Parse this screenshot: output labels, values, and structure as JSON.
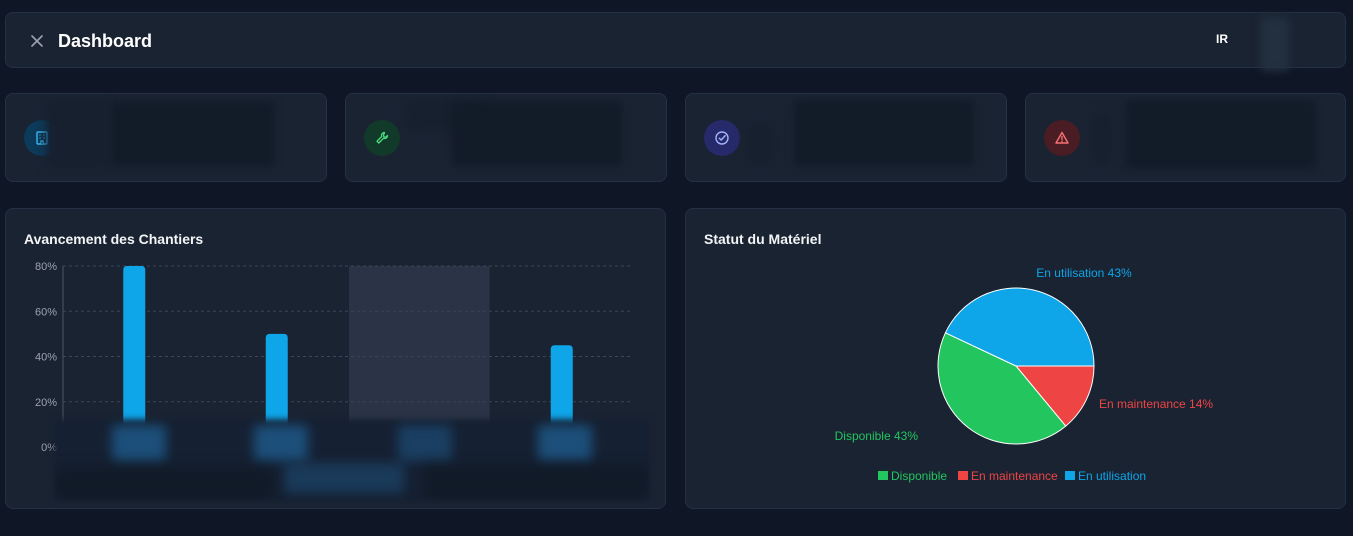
{
  "header": {
    "title": "Dashboard",
    "avatar_initials": "IR",
    "close_icon": "close-icon"
  },
  "stat_cards": [
    {
      "icon": "building-icon",
      "color": "#0ea5e9"
    },
    {
      "icon": "wrench-icon",
      "color": "#22c55e"
    },
    {
      "icon": "check-circle-icon",
      "color": "#6366f1"
    },
    {
      "icon": "alert-triangle-icon",
      "color": "#ef4444"
    }
  ],
  "projects_panel": {
    "title": "Avancement des Chantiers"
  },
  "equipment_panel": {
    "title": "Statut du Matériel"
  },
  "chart_data": [
    {
      "type": "bar",
      "title": "Avancement des Chantiers",
      "y_ticks": [
        "0%",
        "20%",
        "40%",
        "60%",
        "80%"
      ],
      "ylim": [
        0,
        80
      ],
      "values": [
        80,
        50,
        null,
        45
      ],
      "highlighted_index": 2,
      "color": "#0ea5e9",
      "grid": true
    },
    {
      "type": "pie",
      "title": "Statut du Matériel",
      "slices": [
        {
          "label": "Disponible",
          "value": 43,
          "display": "Disponible 43%",
          "color": "#22c55e"
        },
        {
          "label": "En maintenance",
          "value": 14,
          "display": "En maintenance 14%",
          "color": "#ef4444"
        },
        {
          "label": "En utilisation",
          "value": 43,
          "display": "En utilisation 43%",
          "color": "#0ea5e9"
        }
      ],
      "legend": "bottom"
    }
  ]
}
